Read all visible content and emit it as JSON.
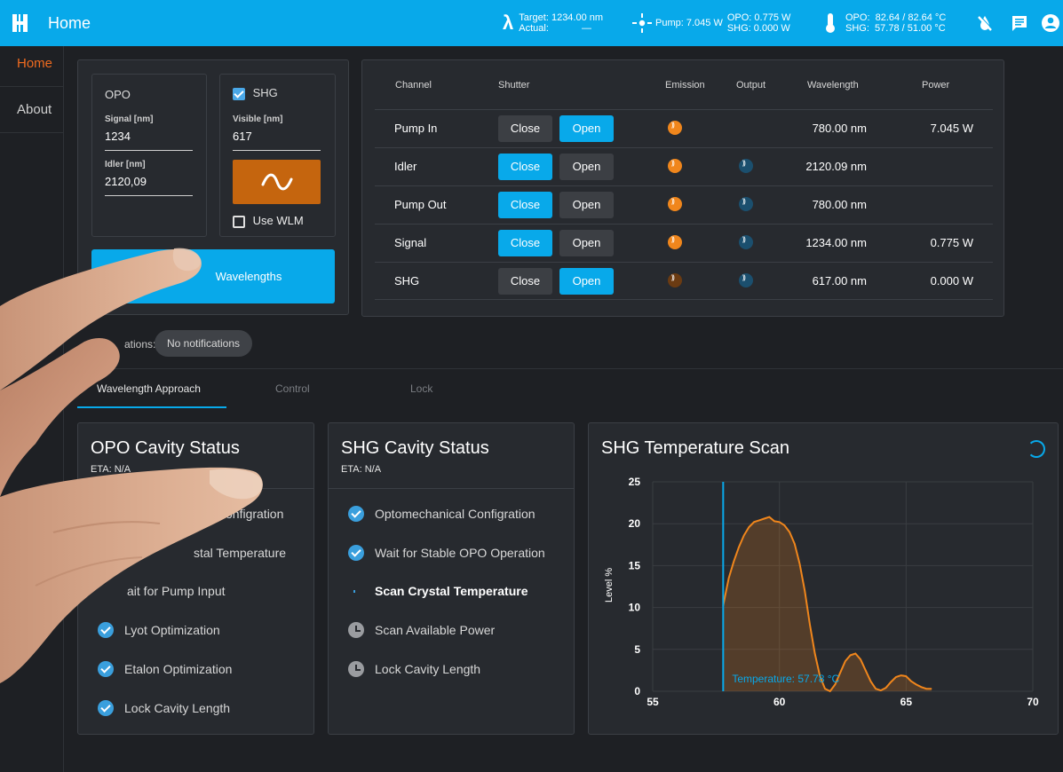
{
  "header": {
    "title": "Home",
    "lambda_symbol": "λ",
    "target_label": "Target:",
    "target_value": "1234.00 nm",
    "actual_label": "Actual:",
    "actual_value": "—",
    "pump_label": "Pump:",
    "pump_value": "7.045 W",
    "opo_power_label": "OPO:",
    "opo_power_value": "0.775 W",
    "shg_power_label": "SHG:",
    "shg_power_value": "0.000 W",
    "opo_temp_label": "OPO:",
    "opo_temp_value": "82.64 / 82.64 °C",
    "shg_temp_label": "SHG:",
    "shg_temp_value": "57.78 / 51.00 °C",
    "icons": [
      "water-off-icon",
      "message-icon",
      "account-icon"
    ],
    "accent_color": "#08a9ea"
  },
  "sidebar": {
    "items": [
      {
        "label": "Home",
        "active": true
      },
      {
        "label": "About",
        "active": false
      }
    ]
  },
  "settings": {
    "opo_title": "OPO",
    "signal_label": "Signal [nm]",
    "signal_value": "1234",
    "idler_label": "Idler [nm]",
    "idler_value": "2120,09",
    "shg_title": "SHG",
    "shg_checked": true,
    "visible_label": "Visible [nm]",
    "visible_value": "617",
    "use_wlm_label": "Use WLM",
    "use_wlm_checked": false,
    "apply_button": "Wavelengths"
  },
  "channels": {
    "headers": [
      "Channel",
      "Shutter",
      "Emission",
      "Output",
      "Wavelength",
      "Power"
    ],
    "close_label": "Close",
    "open_label": "Open",
    "rows": [
      {
        "name": "Pump In",
        "shutter": "open",
        "emission": "on",
        "output": "",
        "wavelength": "780.00 nm",
        "power": "7.045 W"
      },
      {
        "name": "Idler",
        "shutter": "close",
        "emission": "on",
        "output": "dim",
        "wavelength": "2120.09 nm",
        "power": ""
      },
      {
        "name": "Pump Out",
        "shutter": "close",
        "emission": "on",
        "output": "dim",
        "wavelength": "780.00 nm",
        "power": ""
      },
      {
        "name": "Signal",
        "shutter": "close",
        "emission": "on",
        "output": "dim",
        "wavelength": "1234.00 nm",
        "power": "0.775 W"
      },
      {
        "name": "SHG",
        "shutter": "open",
        "emission": "dim",
        "output": "dim",
        "wavelength": "617.00 nm",
        "power": "0.000 W"
      }
    ]
  },
  "notifications": {
    "label": "ations:",
    "value": "No notifications"
  },
  "tabs": [
    {
      "label": "Wavelength Approach",
      "active": true
    },
    {
      "label": "Control",
      "active": false
    },
    {
      "label": "Lock",
      "active": false
    }
  ],
  "opo_status": {
    "title": "OPO Cavity Status",
    "eta": "ETA: N/A",
    "steps": [
      {
        "label": "onfigration",
        "state": "hidden"
      },
      {
        "label": "stal Temperature",
        "state": "hidden"
      },
      {
        "label": "ait for Pump Input",
        "state": "hidden"
      },
      {
        "label": "Lyot Optimization",
        "state": "done"
      },
      {
        "label": "Etalon Optimization",
        "state": "done"
      },
      {
        "label": "Lock Cavity Length",
        "state": "done"
      }
    ]
  },
  "shg_status": {
    "title": "SHG Cavity Status",
    "eta": "ETA: N/A",
    "steps": [
      {
        "label": "Optomechanical Configration",
        "state": "done"
      },
      {
        "label": "Wait for Stable OPO Operation",
        "state": "done"
      },
      {
        "label": "Scan Crystal Temperature",
        "state": "running"
      },
      {
        "label": "Scan Available Power",
        "state": "pending"
      },
      {
        "label": "Lock Cavity Length",
        "state": "pending"
      }
    ]
  },
  "scan_card": {
    "title": "SHG Temperature Scan",
    "temperature_label": "Temperature: 57.78 °C"
  },
  "chart_data": {
    "type": "area",
    "title": "SHG Temperature Scan",
    "xlabel": "",
    "ylabel": "Level %",
    "xlim": [
      55,
      70
    ],
    "ylim": [
      0,
      25
    ],
    "xticks": [
      "55",
      "60",
      "65",
      "70"
    ],
    "yticks": [
      "0",
      "5",
      "10",
      "15",
      "20",
      "25"
    ],
    "grid": true,
    "marker_x": 57.78,
    "line_color": "#f0861c",
    "marker_color": "#08a9ea",
    "series": [
      {
        "x": [
          57.78,
          57.9,
          58.0,
          58.2,
          58.4,
          58.6,
          58.8,
          59.0,
          59.2,
          59.4,
          59.6,
          59.8,
          60.0,
          60.2,
          60.4,
          60.6,
          60.8,
          61.0,
          61.2,
          61.4,
          61.6,
          61.8,
          62.0,
          62.2,
          62.4,
          62.6,
          62.8,
          63.0,
          63.2,
          63.4,
          63.6,
          63.8,
          64.0,
          64.2,
          64.4,
          64.6,
          64.8,
          65.0,
          65.2,
          65.4,
          65.6,
          65.8,
          66.0
        ],
        "y": [
          10.2,
          12.0,
          13.5,
          15.5,
          17.2,
          18.6,
          19.6,
          20.2,
          20.4,
          20.6,
          20.8,
          20.3,
          20.2,
          19.8,
          19.0,
          17.6,
          15.2,
          12.0,
          8.0,
          4.5,
          1.8,
          0.3,
          0.0,
          0.8,
          2.2,
          3.6,
          4.3,
          4.5,
          3.8,
          2.5,
          1.2,
          0.3,
          0.1,
          0.4,
          1.1,
          1.7,
          1.9,
          1.8,
          1.2,
          0.8,
          0.5,
          0.3,
          0.3
        ]
      }
    ]
  }
}
